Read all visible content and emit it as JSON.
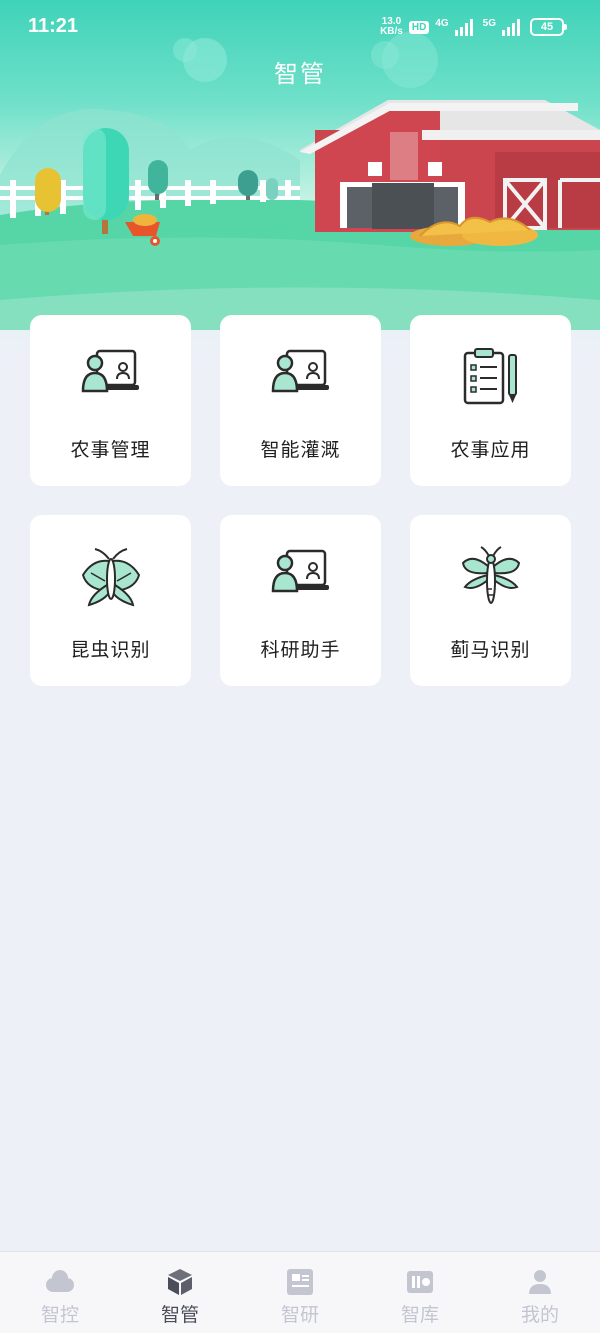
{
  "status": {
    "time": "11:21",
    "net_speed_value": "13.0",
    "net_speed_unit": "KB/s",
    "hd": "HD",
    "net_4g": "4G",
    "net_5g": "5G",
    "battery": "45"
  },
  "header": {
    "title": "智管"
  },
  "cards": [
    {
      "label": "农事管理",
      "icon": "teacher-screen-icon"
    },
    {
      "label": "智能灌溉",
      "icon": "teacher-screen-icon"
    },
    {
      "label": "农事应用",
      "icon": "clipboard-checklist-icon"
    },
    {
      "label": "昆虫识别",
      "icon": "moth-icon"
    },
    {
      "label": "科研助手",
      "icon": "teacher-screen-icon"
    },
    {
      "label": "蓟马识别",
      "icon": "thrips-insect-icon"
    }
  ],
  "tabbar": {
    "active_index": 1,
    "items": [
      {
        "label": "智控",
        "icon": "cloud-icon"
      },
      {
        "label": "智管",
        "icon": "cube-icon"
      },
      {
        "label": "智研",
        "icon": "document-board-icon"
      },
      {
        "label": "智库",
        "icon": "library-icon"
      },
      {
        "label": "我的",
        "icon": "user-icon"
      }
    ]
  },
  "colors": {
    "accent": "#3fd3b9",
    "page_bg": "#eef0f8",
    "card_bg": "#ffffff",
    "icon_fill": "#a8e6cf",
    "tab_active": "#4b4e58",
    "tab_inactive": "#c3c6d1"
  }
}
